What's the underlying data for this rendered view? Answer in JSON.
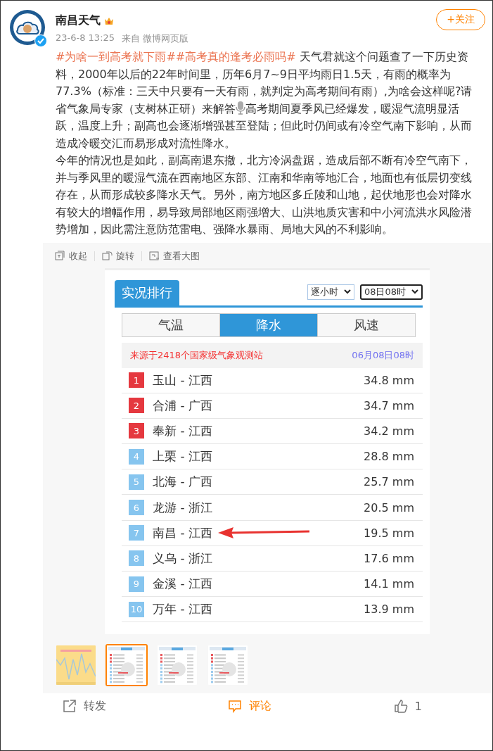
{
  "post": {
    "author": "南昌天气",
    "time": "23-6-8 13:25",
    "source": "来自 微博网页版",
    "follow_button": "+关注",
    "paragraphs": [
      [
        {
          "kind": "topic",
          "text": "#为啥一到高考就下雨#"
        },
        {
          "kind": "topic",
          "text": "#高考真的逢考必雨吗#"
        },
        {
          "kind": "text",
          "text": " 天气君就这个问题查了一下历史资料，2000年以后的22年时间里，历年6月7~9日平均雨日1.5天，有雨的概率为77.3%（标准：三天中只要有一天有雨，就判定为高考期间有雨）,为啥会这样呢?请省气象局专家（支树林正研）来解答"
        },
        {
          "kind": "mic"
        },
        {
          "kind": "text",
          "text": "高考期间夏季风已经爆发，暖湿气流明显活跃，温度上升；副高也会逐渐增强甚至登陆；但此时仍间或有冷空气南下影响，从而造成冷暖交汇而易形成对流性降水。"
        }
      ],
      [
        {
          "kind": "text",
          "text": "今年的情况也是如此，副高南退东撤，北方冷涡盘踞，造成后部不断有冷空气南下，并与季风里的暖湿气流在西南地区东部、江南和华南等地汇合，地面也有低层切变线存在，从而形成较多降水天气。另外，南方地区多丘陵和山地，起伏地形也会对降水有较大的增幅作用，易导致局部地区雨强增大、山洪地质灾害和中小河流洪水风险潜势增加，因此需注意防范雷电、强降水暴雨、局地大风的不利影响。"
        }
      ]
    ]
  },
  "media_toolbar": [
    "收起",
    "旋转",
    "查看大图"
  ],
  "ranking": {
    "title": "实况排行",
    "selects": [
      {
        "value": "逐小时",
        "focused": false
      },
      {
        "value": "08日08时",
        "focused": true
      }
    ],
    "tabs": [
      {
        "label": "气温",
        "selected": false
      },
      {
        "label": "降水",
        "selected": true
      },
      {
        "label": "风速",
        "selected": false
      }
    ],
    "source": "来源于2418个国家级气象观测站",
    "time": "06月08日08时",
    "rows": [
      {
        "rank": "1",
        "place": "玉山 - 江西",
        "value": "34.8 mm",
        "top": true,
        "marked": false
      },
      {
        "rank": "2",
        "place": "合浦 - 广西",
        "value": "34.7 mm",
        "top": true,
        "marked": false
      },
      {
        "rank": "3",
        "place": "奉新 - 江西",
        "value": "34.2 mm",
        "top": true,
        "marked": false
      },
      {
        "rank": "4",
        "place": "上栗 - 江西",
        "value": "28.8 mm",
        "top": false,
        "marked": false
      },
      {
        "rank": "5",
        "place": "北海 - 广西",
        "value": "25.7 mm",
        "top": false,
        "marked": false
      },
      {
        "rank": "6",
        "place": "龙游 - 浙江",
        "value": "20.5 mm",
        "top": false,
        "marked": false
      },
      {
        "rank": "7",
        "place": "南昌 - 江西",
        "value": "19.5 mm",
        "top": false,
        "marked": true
      },
      {
        "rank": "8",
        "place": "义乌 - 浙江",
        "value": "17.6 mm",
        "top": false,
        "marked": false
      },
      {
        "rank": "9",
        "place": "金溪 - 江西",
        "value": "14.1 mm",
        "top": false,
        "marked": false
      },
      {
        "rank": "10",
        "place": "万年 - 江西",
        "value": "13.9 mm",
        "top": false,
        "marked": false
      }
    ]
  },
  "thumbnails": [
    {
      "kind": "chart",
      "selected": false
    },
    {
      "kind": "table",
      "selected": true
    },
    {
      "kind": "table",
      "selected": false
    },
    {
      "kind": "table",
      "selected": false
    }
  ],
  "actions": [
    {
      "kind": "repost",
      "label": "转发",
      "active": false
    },
    {
      "kind": "comment",
      "label": "评论",
      "active": true
    },
    {
      "kind": "like",
      "label": "1",
      "active": false
    }
  ]
}
